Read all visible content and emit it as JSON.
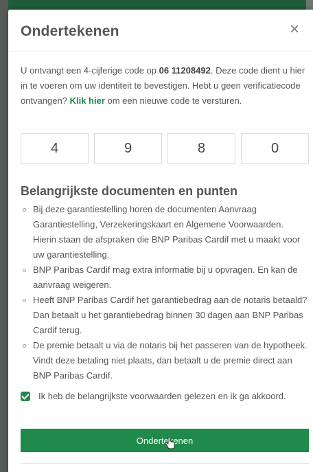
{
  "modal": {
    "title": "Ondertekenen",
    "close_glyph": "×",
    "intro": {
      "part1": "U ontvangt een 4-cijferige code op ",
      "phone": "06 11208492",
      "part2": ". Deze code dient u hier in te voeren om uw identiteit te bevestigen. Hebt u geen verificatiecode ontvangen? ",
      "link": "Klik hier",
      "part3": " om een nieuwe code te versturen."
    },
    "code_digits": [
      "4",
      "9",
      "8",
      "0"
    ],
    "section_title": "Belangrijkste documenten en punten",
    "items": [
      "Bij deze garantiestelling horen de documenten Aanvraag Garantiestelling, Verzekeringskaart en Algemene Voorwaarden. Hierin staan de afspraken die BNP Paribas Cardif met u maakt voor uw garantiestelling.",
      "BNP Paribas Cardif mag extra informatie bij u opvragen. En kan de aanvraag weigeren.",
      "Heeft BNP Paribas Cardif het garantiebedrag aan de notaris betaald? Dan betaalt u het garantiebedrag binnen 30 dagen aan BNP Paribas Cardif terug.",
      "De premie betaalt u via de notaris bij het passeren van de hypotheek. Vindt deze betaling niet plaats, dan betaalt u de premie direct aan BNP Paribas Cardif."
    ],
    "consent": {
      "checked": true,
      "label": "Ik heb de belangrijkste voorwaarden gelezen en ik ga akkoord."
    },
    "submit_label": "Ondertekenen"
  },
  "colors": {
    "accent": "#1f8a4c",
    "top_strip": "#1f5d3a",
    "text": "#555555"
  },
  "icons": {
    "close": "close-icon",
    "check": "checkmark-icon",
    "cursor": "hand-pointer-icon"
  }
}
